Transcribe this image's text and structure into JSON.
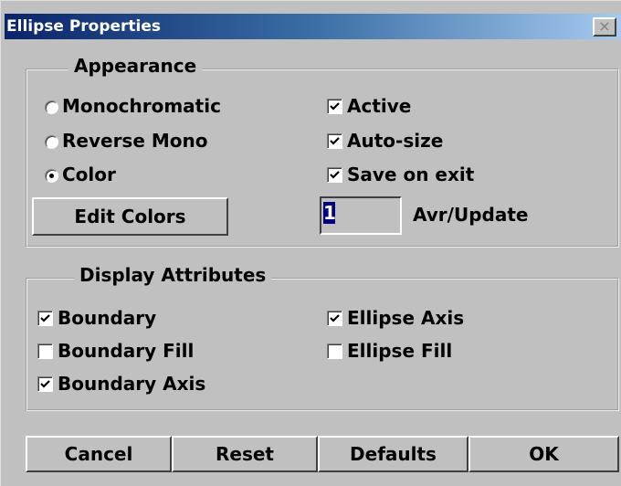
{
  "window": {
    "title": "Ellipse Properties",
    "close_label": "×"
  },
  "appearance": {
    "legend": "Appearance",
    "radios": [
      {
        "label": "Monochromatic",
        "checked": false
      },
      {
        "label": "Reverse Mono",
        "checked": false
      },
      {
        "label": "Color",
        "checked": true
      }
    ],
    "edit_colors_label": "Edit Colors",
    "checks": [
      {
        "label": "Active",
        "checked": true
      },
      {
        "label": "Auto-size",
        "checked": true
      },
      {
        "label": "Save on exit",
        "checked": true
      }
    ],
    "avr_value": "1",
    "avr_label": "Avr/Update"
  },
  "display": {
    "legend": "Display Attributes",
    "checks": [
      {
        "label": "Boundary",
        "checked": true
      },
      {
        "label": "Boundary Fill",
        "checked": false
      },
      {
        "label": "Boundary Axis",
        "checked": true
      },
      {
        "label": "Ellipse Axis",
        "checked": true
      },
      {
        "label": "Ellipse Fill",
        "checked": false
      }
    ]
  },
  "buttons": {
    "cancel": "Cancel",
    "reset": "Reset",
    "defaults": "Defaults",
    "ok": "OK"
  }
}
